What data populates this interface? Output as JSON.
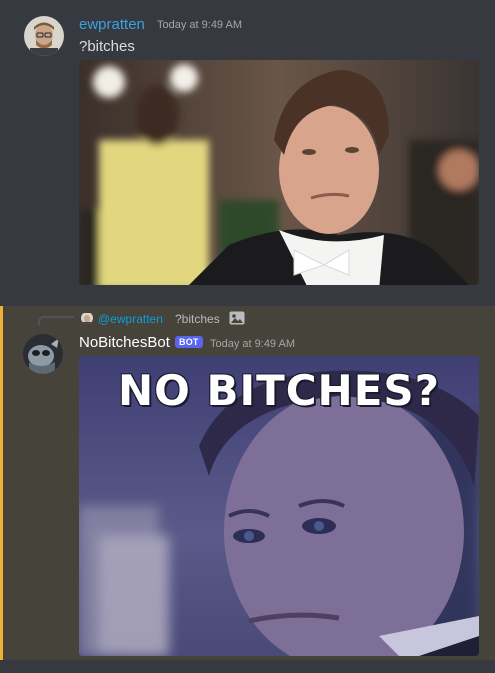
{
  "messages": [
    {
      "username": "ewpratten",
      "timestamp": "Today at 9:49 AM",
      "text": "?bitches"
    },
    {
      "reply": {
        "mention": "@ewpratten",
        "text": "?bitches",
        "icon": "image-icon"
      },
      "username": "NoBitchesBot",
      "badge": "BOT",
      "timestamp": "Today at 9:49 AM",
      "image_caption": "NO BITCHES?"
    }
  ],
  "colors": {
    "background": "#36393f",
    "highlight_background": "#46433a",
    "highlight_border": "#f0b232",
    "user1_name": "#3ba2e0",
    "bot_name": "#ffffff",
    "bot_badge": "#5865f2",
    "mention": "#00aff4"
  }
}
